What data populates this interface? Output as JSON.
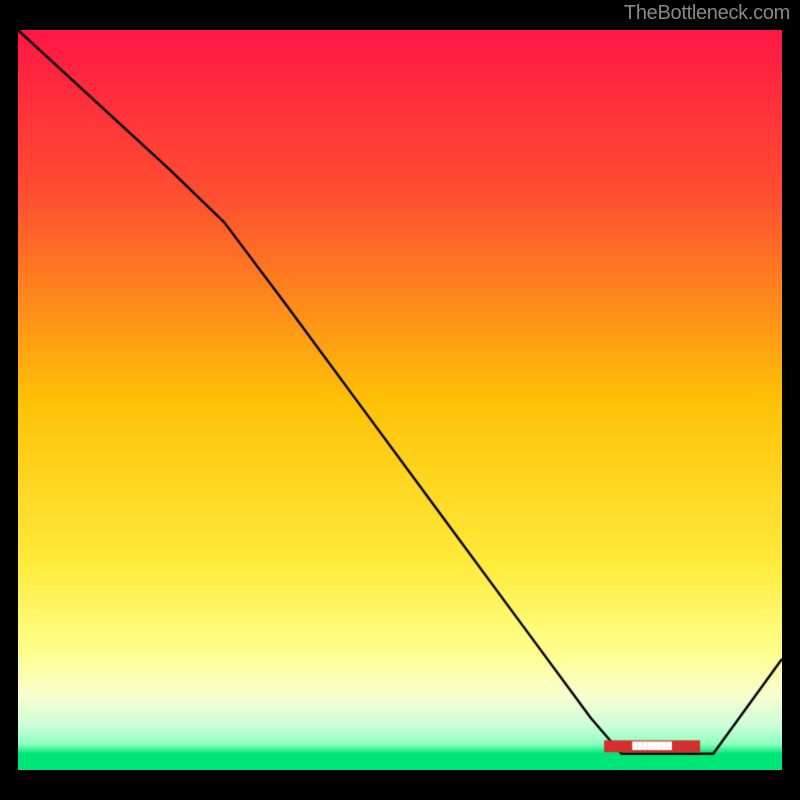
{
  "attribution": "TheBottleneck.com",
  "chart_data": {
    "type": "line",
    "title": "",
    "xlabel": "",
    "ylabel": "",
    "xlim": [
      0,
      100
    ],
    "ylim": [
      0,
      100
    ],
    "gradient_stops": [
      {
        "t": 0.0,
        "color": "#ff1744"
      },
      {
        "t": 0.23,
        "color": "#ff5030"
      },
      {
        "t": 0.5,
        "color": "#ffc107"
      },
      {
        "t": 0.72,
        "color": "#ffeb3b"
      },
      {
        "t": 0.84,
        "color": "#ffff8d"
      },
      {
        "t": 0.9,
        "color": "#f8ffd0"
      },
      {
        "t": 0.94,
        "color": "#ccffd8"
      },
      {
        "t": 0.965,
        "color": "#8dffc0"
      },
      {
        "t": 0.978,
        "color": "#00e676"
      }
    ],
    "series": [
      {
        "name": "bottleneck-curve",
        "color": "#000000",
        "x": [
          0,
          10,
          20,
          27,
          35,
          45,
          55,
          65,
          75,
          79,
          83,
          87,
          91,
          100
        ],
        "y": [
          100,
          90.5,
          81,
          74,
          63,
          49,
          35,
          21,
          7,
          2.2,
          2.2,
          2.2,
          2.2,
          15
        ]
      }
    ],
    "annotations": [
      {
        "x": 83,
        "y": 3.2,
        "text": "",
        "color": "#d32f2f",
        "note": "recommended-badge"
      }
    ]
  }
}
